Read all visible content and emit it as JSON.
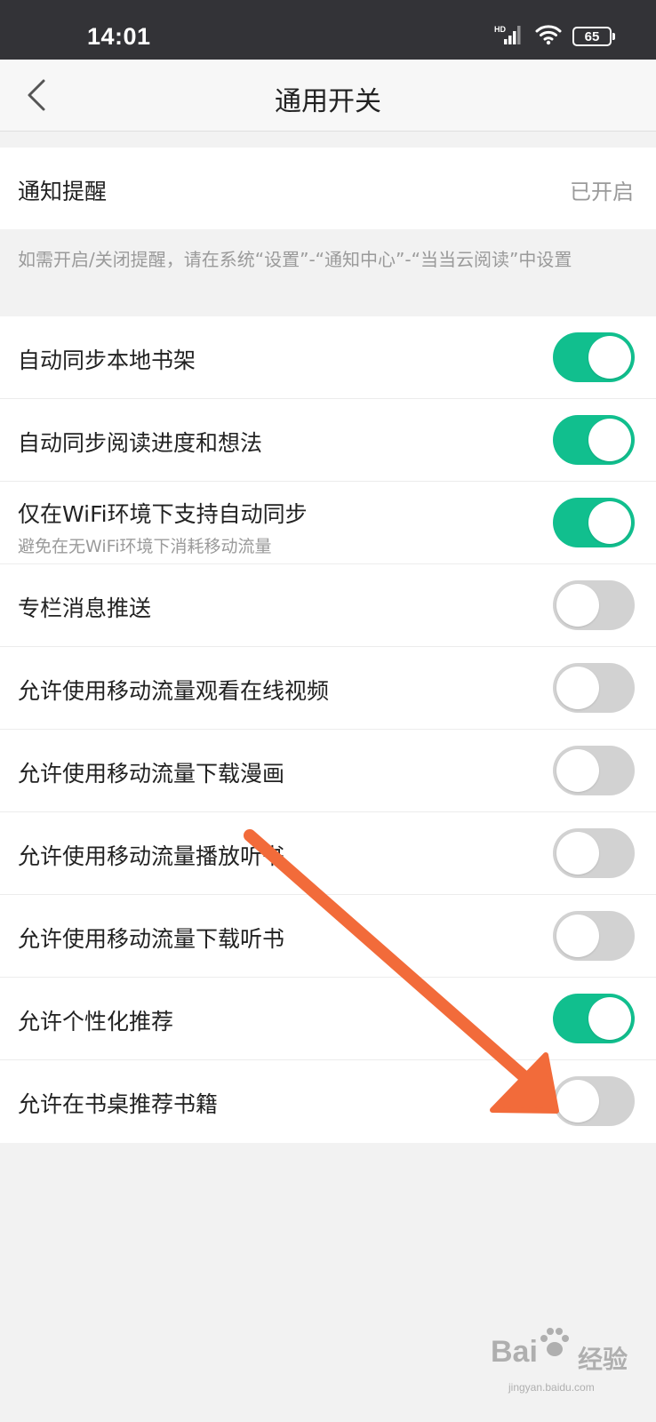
{
  "status_bar": {
    "time": "14:01",
    "network_badge": "HD",
    "battery_level": "65"
  },
  "nav": {
    "title": "通用开关"
  },
  "notification": {
    "label": "通知提醒",
    "status": "已开启",
    "notice": "如需开启/关闭提醒，请在系统“设置”-“通知中心”-“当当云阅读”中设置"
  },
  "toggles": [
    {
      "label": "自动同步本地书架",
      "state": "on"
    },
    {
      "label": "自动同步阅读进度和想法",
      "state": "on"
    },
    {
      "label": "仅在WiFi环境下支持自动同步",
      "sub": "避免在无WiFi环境下消耗移动流量",
      "state": "on"
    },
    {
      "label": "专栏消息推送",
      "state": "off"
    },
    {
      "label": "允许使用移动流量观看在线视频",
      "state": "off"
    },
    {
      "label": "允许使用移动流量下载漫画",
      "state": "off"
    },
    {
      "label": "允许使用移动流量播放听书",
      "state": "off"
    },
    {
      "label": "允许使用移动流量下载听书",
      "state": "off"
    },
    {
      "label": "允许个性化推荐",
      "state": "on"
    },
    {
      "label": "允许在书桌推荐书籍",
      "state": "off"
    }
  ],
  "colors": {
    "switch_on": "#11bf8e",
    "switch_off": "#d2d2d2",
    "annotation_arrow": "#f26b3a"
  },
  "watermark": {
    "brand": "Bai",
    "brand_suffix": "经验",
    "url": "jingyan.baidu.com"
  }
}
